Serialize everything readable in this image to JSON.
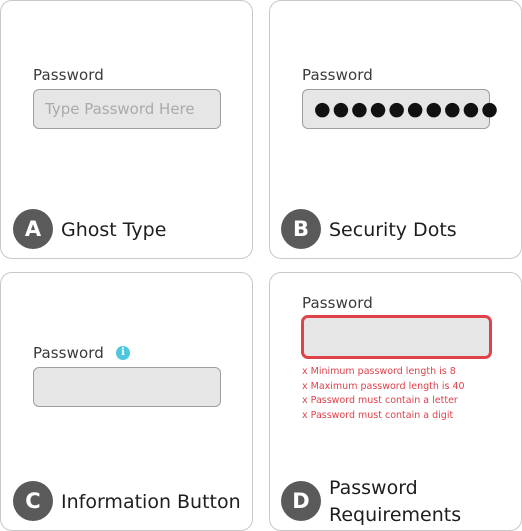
{
  "cards": {
    "a": {
      "letter": "A",
      "caption": "Ghost Type",
      "label": "Password",
      "placeholder": "Type Password Here"
    },
    "b": {
      "letter": "B",
      "caption": "Security Dots",
      "label": "Password",
      "masked_value": "●●●●●●●●●●"
    },
    "c": {
      "letter": "C",
      "caption": "Information Button",
      "label": "Password",
      "info_glyph": "i",
      "info_icon_name": "info-icon"
    },
    "d": {
      "letter": "D",
      "caption_line1": "Password",
      "caption_line2": "Requirements",
      "label": "Password",
      "errors": [
        "x Minimum password length is 8",
        "x Maximum password length is 40",
        "x Password must contain a letter",
        "x Password must contain a digit"
      ]
    }
  },
  "colors": {
    "error": "#e0424a",
    "info": "#4cc7df",
    "badge": "#5a5a5a",
    "field_bg": "#e6e6e6"
  }
}
